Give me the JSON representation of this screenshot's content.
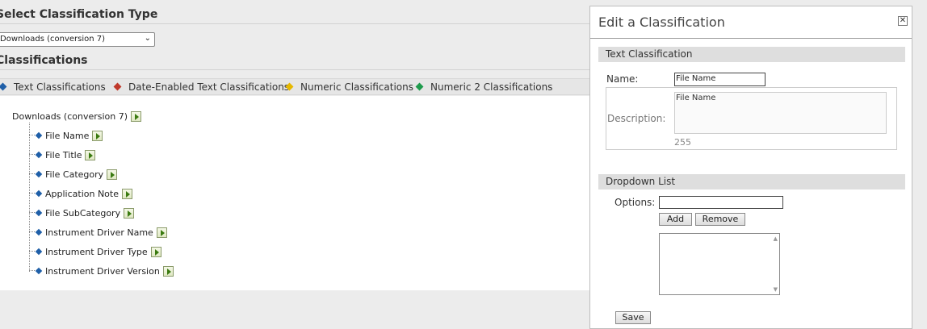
{
  "main": {
    "select_heading": "Select Classification Type",
    "type_select_value": "Downloads (conversion 7)",
    "classifications_heading": "Classifications",
    "legend": [
      {
        "label": "Text Classifications",
        "color": "#1f5fa8"
      },
      {
        "label": "Date-Enabled Text Classifications",
        "color": "#c0392b"
      },
      {
        "label": "Numeric Classifications",
        "color": "#e6b800"
      },
      {
        "label": "Numeric 2 Classifications",
        "color": "#1e9b4c"
      }
    ],
    "tree": {
      "root": "Downloads (conversion 7)",
      "children": [
        "File Name",
        "File Title",
        "File Category",
        "Application Note",
        "File SubCategory",
        "Instrument Driver Name",
        "Instrument Driver Type",
        "Instrument Driver Version"
      ]
    }
  },
  "panel": {
    "title": "Edit a Classification",
    "close_glyph": "✕",
    "text_section": {
      "heading": "Text Classification",
      "name_label": "Name:",
      "name_value": "File Name",
      "description_label": "Description:",
      "description_value": "File Name",
      "char_count": "255"
    },
    "dropdown_section": {
      "heading": "Dropdown List",
      "options_label": "Options:",
      "options_value": "",
      "add_label": "Add",
      "remove_label": "Remove"
    },
    "save_label": "Save"
  }
}
